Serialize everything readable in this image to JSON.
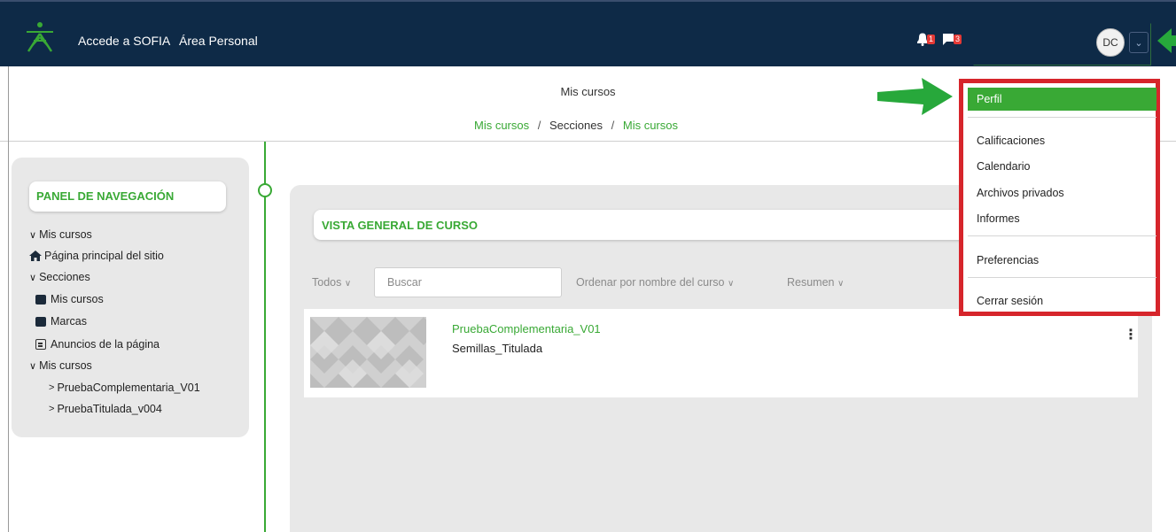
{
  "navbar": {
    "link_sofia": "Accede a SOFIA",
    "link_area": "Área Personal",
    "notifications_count": "1",
    "messages_count": "3",
    "user_initials": "DC",
    "caret": "⌄",
    "bg_color": "#0e2a47"
  },
  "header": {
    "page_title": "Mis cursos",
    "breadcrumb": [
      "Mis cursos",
      "/",
      "Secciones",
      "/",
      "Mis cursos"
    ]
  },
  "nav_panel": {
    "title": "PANEL DE NAVEGACIÓN",
    "items": [
      {
        "label": "Mis cursos",
        "icon": "chevron-down-icon"
      },
      {
        "label": "Página principal del sitio",
        "icon": "home-icon"
      },
      {
        "label": "Secciones",
        "icon": "chevron-down-icon"
      },
      {
        "label": "Mis cursos",
        "icon": "square-icon"
      },
      {
        "label": "Marcas",
        "icon": "square-icon"
      },
      {
        "label": "Anuncios de la página",
        "icon": "forum-icon"
      },
      {
        "label": "Mis cursos",
        "icon": "chevron-down-icon"
      },
      {
        "label": "PruebaComplementaria_V01",
        "icon": "chevron-right-icon"
      },
      {
        "label": "PruebaTitulada_v004",
        "icon": "chevron-right-icon"
      }
    ]
  },
  "overview": {
    "title": "VISTA GENERAL DE CURSO",
    "filter_all": "Todos",
    "search_placeholder": "Buscar",
    "sort": "Ordenar por nombre del curso",
    "view": "Resumen",
    "courses": [
      {
        "name": "PruebaComplementaria_V01",
        "category": "Semillas_Titulada"
      }
    ]
  },
  "user_menu": {
    "items": [
      "Perfil",
      "Calificaciones",
      "Calendario",
      "Archivos privados",
      "Informes",
      "Preferencias",
      "Cerrar sesión"
    ]
  },
  "colors": {
    "accent": "#39a935",
    "highlight_border": "#d6252b",
    "panel": "#e8e8e8"
  }
}
